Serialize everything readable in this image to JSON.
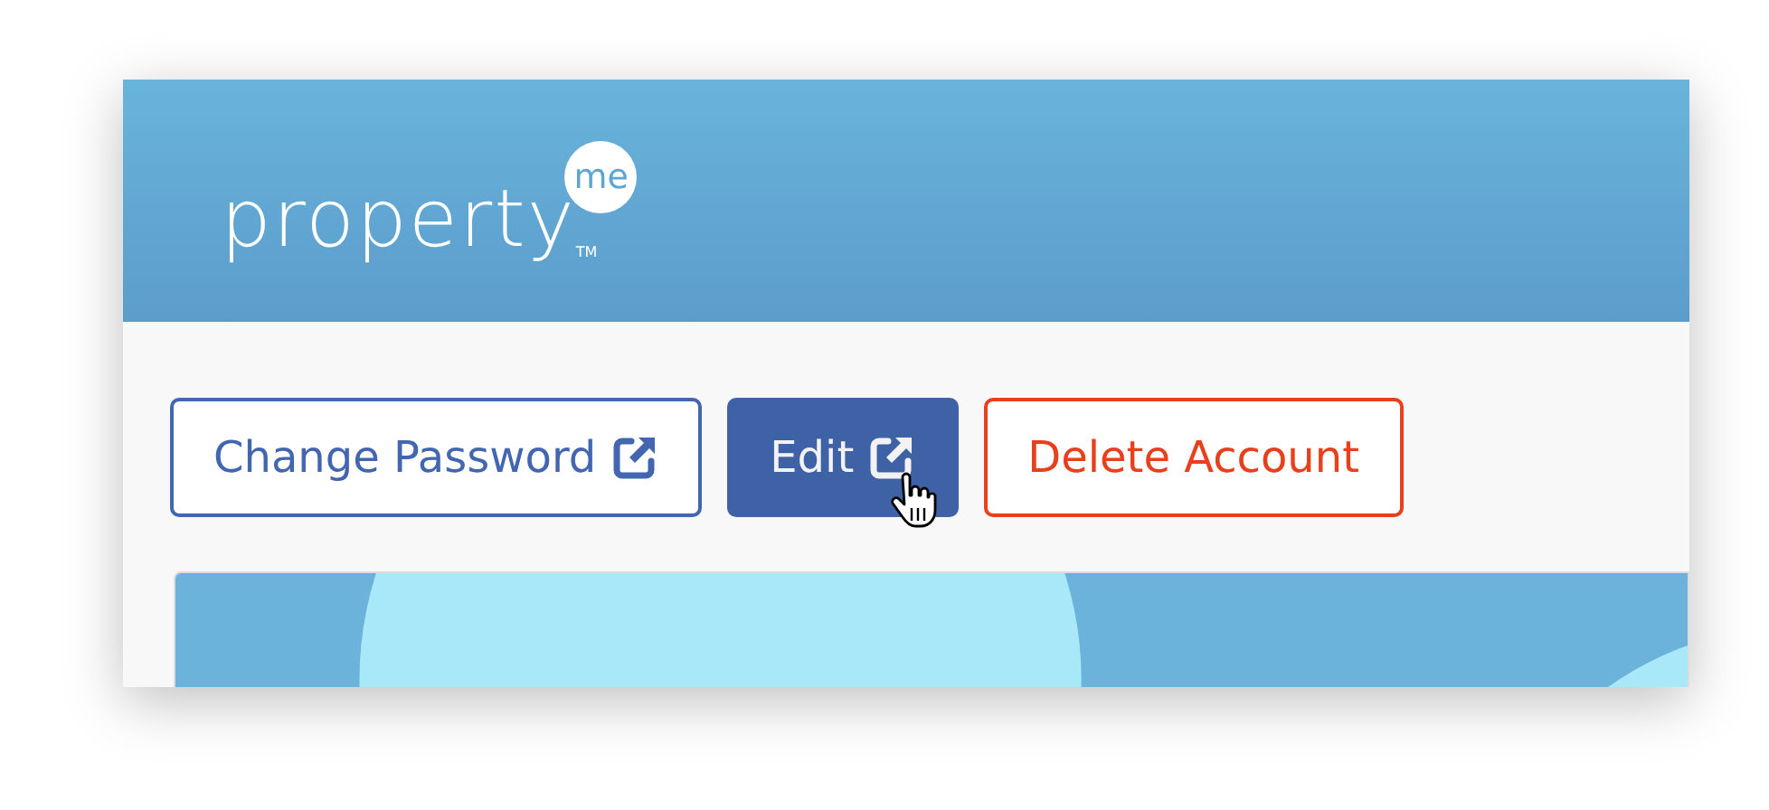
{
  "header": {
    "logo": {
      "word": "property",
      "badge": "me",
      "trademark": "TM"
    }
  },
  "actions": [
    {
      "label": "Change Password",
      "kind": "outline",
      "external": true,
      "hovered": false
    },
    {
      "label": "Edit",
      "kind": "primary",
      "external": true,
      "hovered": true
    },
    {
      "label": "Delete Account",
      "kind": "danger",
      "external": false,
      "hovered": false
    }
  ]
}
